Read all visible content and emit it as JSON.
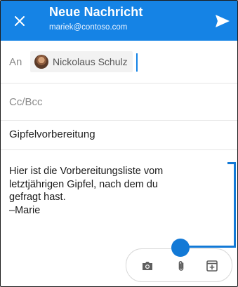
{
  "header": {
    "title": "Neue Nachricht",
    "account": "mariek@contoso.com",
    "close_icon": "close-icon",
    "send_icon": "send-icon",
    "color": "#1583e5"
  },
  "to": {
    "label": "An",
    "recipient": "Nickolaus Schulz"
  },
  "cc": {
    "label": "Cc/Bcc"
  },
  "subject": {
    "value": "Gipfelvorbereitung"
  },
  "body": {
    "lines": [
      "Hier ist die Vorbereitungsliste vom",
      "letztjährigen Gipfel, nach dem du",
      "gefragt hast.",
      "–Marie"
    ]
  },
  "toolbar": {
    "items": [
      "camera-icon",
      "paperclip-icon",
      "add-box-icon"
    ]
  },
  "callout_color": "#1279d6"
}
